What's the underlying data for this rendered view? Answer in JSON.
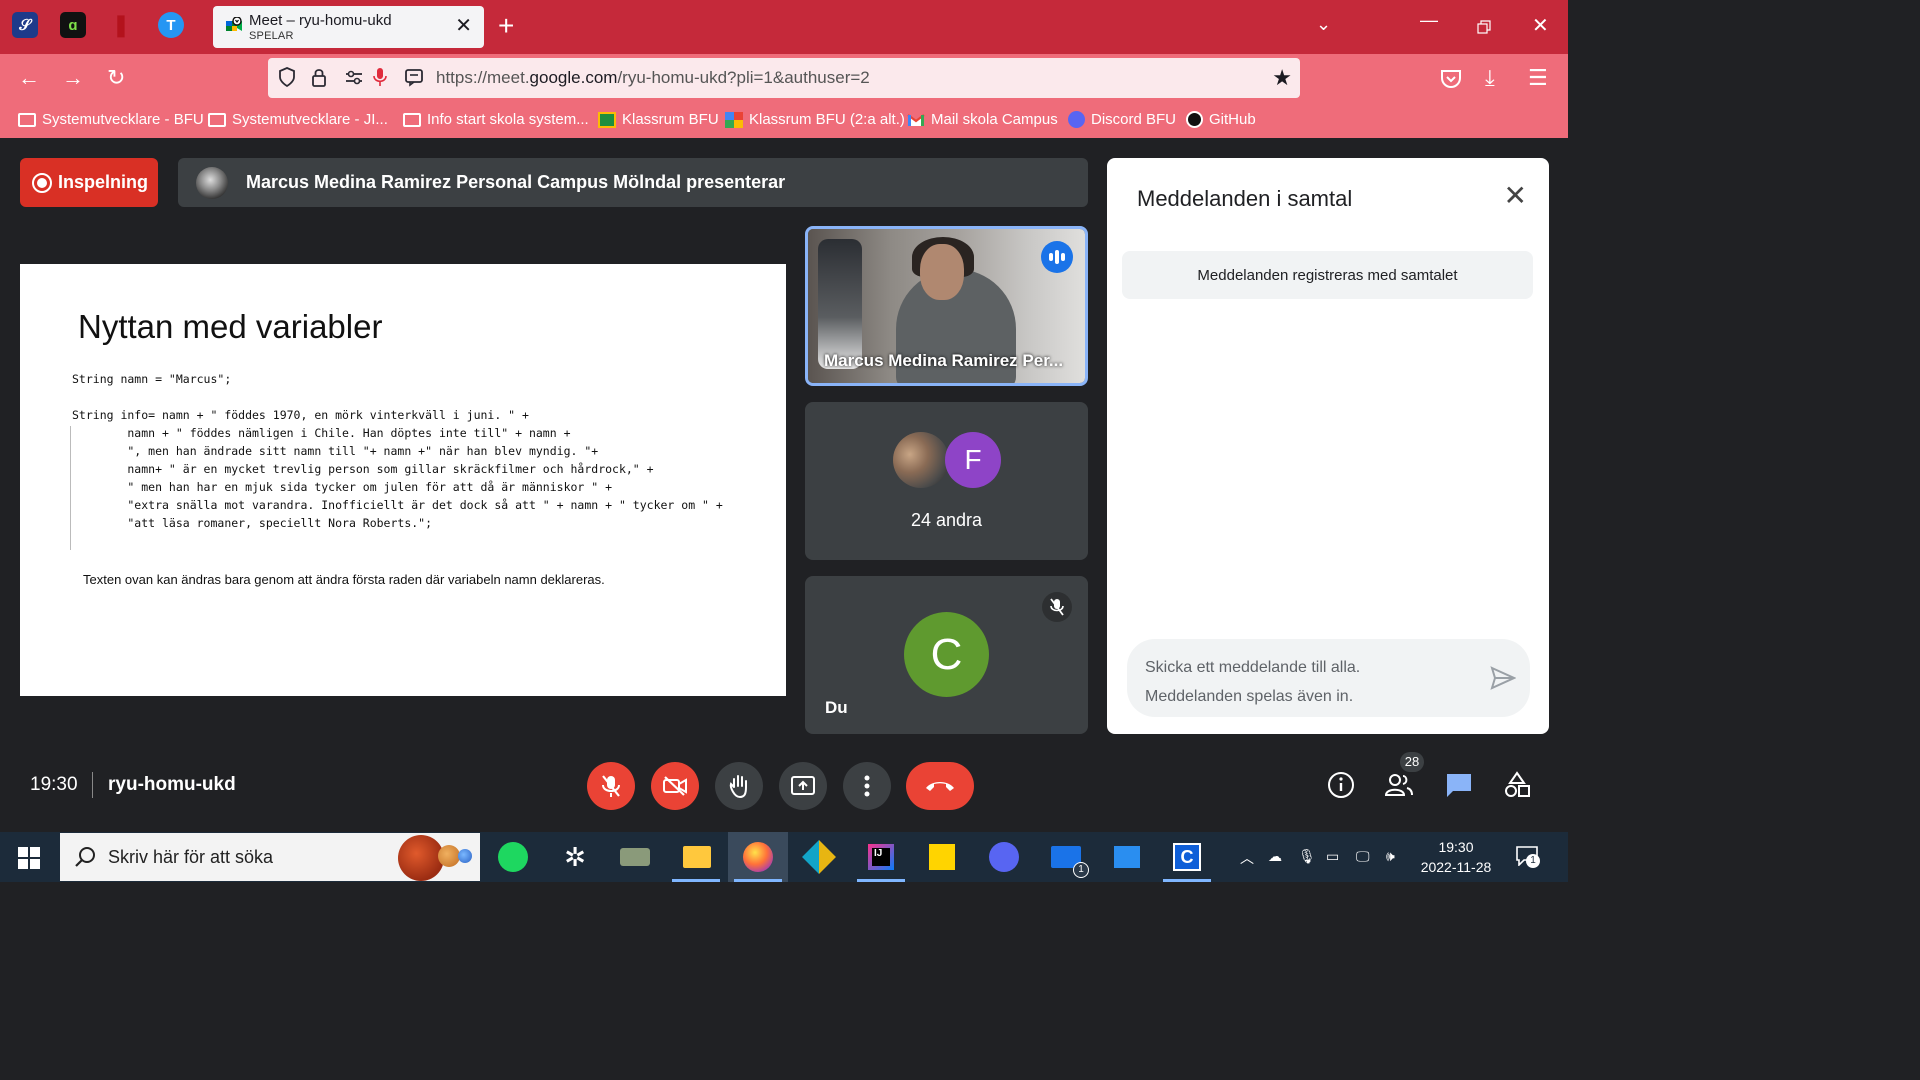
{
  "browser": {
    "tab": {
      "title": "Meet – ryu-homu-ukd",
      "status": "SPELAR"
    },
    "url": {
      "prefix": "https://meet.",
      "domain": "google.com",
      "path": "/ryu-homu-ukd?pli=1&authuser=2"
    },
    "bookmarks": [
      {
        "label": "Systemutvecklare - BFU",
        "icon": "folder-icon"
      },
      {
        "label": "Systemutvecklare - JI...",
        "icon": "folder-icon"
      },
      {
        "label": "Info start skola system...",
        "icon": "folder-icon"
      },
      {
        "label": "Klassrum BFU",
        "icon": "classroom-icon"
      },
      {
        "label": "Klassrum BFU (2:a alt.)",
        "icon": "classroom-icon"
      },
      {
        "label": "Mail skola Campus",
        "icon": "gmail-icon"
      },
      {
        "label": "Discord BFU",
        "icon": "discord-icon"
      },
      {
        "label": "GitHub",
        "icon": "github-icon"
      }
    ]
  },
  "meet": {
    "recording_label": "Inspelning",
    "presenter_banner": "Marcus Medina Ramirez Personal Campus Mölndal presenterar",
    "slide": {
      "title": "Nyttan med variabler",
      "code": [
        "String namn = \"Marcus\";",
        "",
        "String info= namn + \" föddes 1970, en mörk vinterkväll i juni. \" +",
        "        namn + \" föddes nämligen i Chile. Han döptes inte till\" + namn +",
        "        \", men han ändrade sitt namn till \"+ namn +\" när han blev myndig. \"+",
        "        namn+ \" är en mycket trevlig person som gillar skräckfilmer och hårdrock,\" +",
        "        \" men han har en mjuk sida tycker om julen för att då är människor \" +",
        "        \"extra snälla mot varandra. Inofficiellt är det dock så att \" + namn + \" tycker om \" +",
        "        \"att läsa romaner, speciellt Nora Roberts.\";"
      ],
      "footer": "Texten ovan kan ändras bara genom att ändra första raden där variabeln namn deklareras."
    },
    "tiles": {
      "presenter_name": "Marcus Medina Ramirez Per...",
      "others_avatar_letter": "F",
      "others_label": "24 andra",
      "self_avatar_letter": "C",
      "self_label": "Du"
    },
    "chat": {
      "title": "Meddelanden i samtal",
      "notice": "Meddelanden registreras med samtalet",
      "input_placeholder_line1": "Skicka ett meddelande till alla.",
      "input_placeholder_line2": "Meddelanden spelas även in."
    },
    "bottom_bar": {
      "time": "19:30",
      "meeting_code": "ryu-homu-ukd",
      "participants_count": "28"
    }
  },
  "taskbar": {
    "search_placeholder": "Skriv här för att söka",
    "clock_time": "19:30",
    "clock_date": "2022-11-28",
    "mail_badge": "1",
    "notification_badge": "1"
  },
  "colors": {
    "tabbar": "#c5293a",
    "navbar": "#ef6c7a",
    "meet_bg": "#202124",
    "tile_bg": "#3c4043",
    "danger": "#ea4335",
    "accent": "#1a73e8"
  }
}
